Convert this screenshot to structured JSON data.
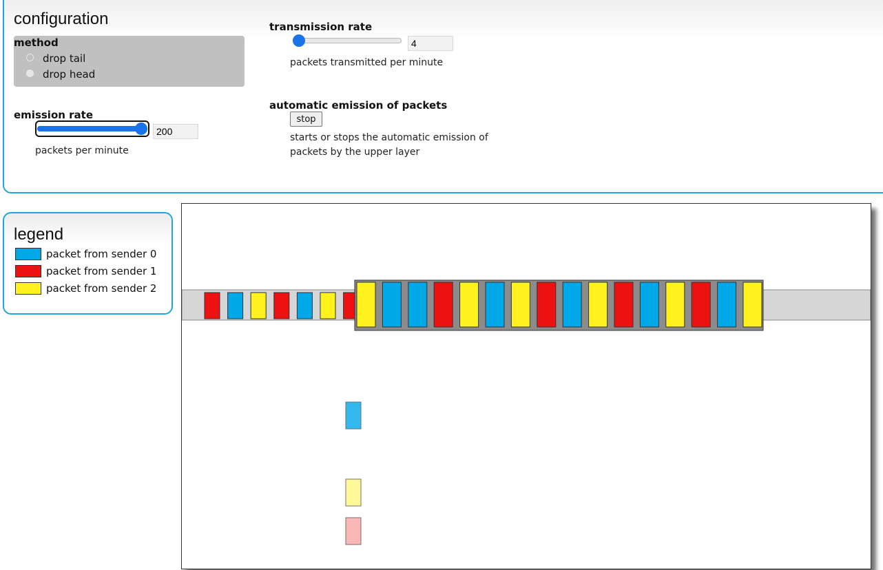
{
  "colors": {
    "sender0": "#00a8e8",
    "sender1": "#ee1111",
    "sender2": "#fff21d",
    "panel_border": "#1aa7dc",
    "slider_accent": "#1a73e8",
    "queue_bg": "#8c8c8c",
    "link_bg": "#d6d6d6"
  },
  "config": {
    "title": "configuration",
    "method": {
      "title": "method",
      "options": [
        {
          "label": "drop tail",
          "selected": false
        },
        {
          "label": "drop head",
          "selected": false
        }
      ]
    },
    "emission_rate": {
      "title": "emission rate",
      "value": "200",
      "slider_fraction": 1.0,
      "description": "packets per minute"
    },
    "transmission_rate": {
      "title": "transmission rate",
      "value": "4",
      "slider_fraction": 0.0,
      "description": "packets transmitted per minute"
    },
    "automatic_emission": {
      "title": "automatic emission of packets",
      "button_label": "stop",
      "description_line1": "starts or stops the automatic emission of",
      "description_line2": "packets by the upper layer"
    }
  },
  "legend": {
    "title": "legend",
    "items": [
      {
        "label": "packet from sender 0",
        "color_key": "sender0",
        "icon": "blue-swatch-icon"
      },
      {
        "label": "packet from sender 1",
        "color_key": "sender1",
        "icon": "red-swatch-icon"
      },
      {
        "label": "packet from sender 2",
        "color_key": "sender2",
        "icon": "yellow-swatch-icon"
      }
    ]
  },
  "simulation": {
    "incoming_packets": [
      1,
      0,
      2,
      1,
      0,
      2,
      1
    ],
    "queue_packets": [
      2,
      0,
      0,
      1,
      2,
      0,
      2,
      1,
      0,
      2,
      1,
      0,
      2,
      1,
      0,
      2
    ],
    "falling_packets": [
      {
        "sender": 0,
        "opacity": 0.8
      },
      {
        "sender": 2,
        "opacity": 0.45
      },
      {
        "sender": 1,
        "opacity": 0.3
      }
    ]
  }
}
